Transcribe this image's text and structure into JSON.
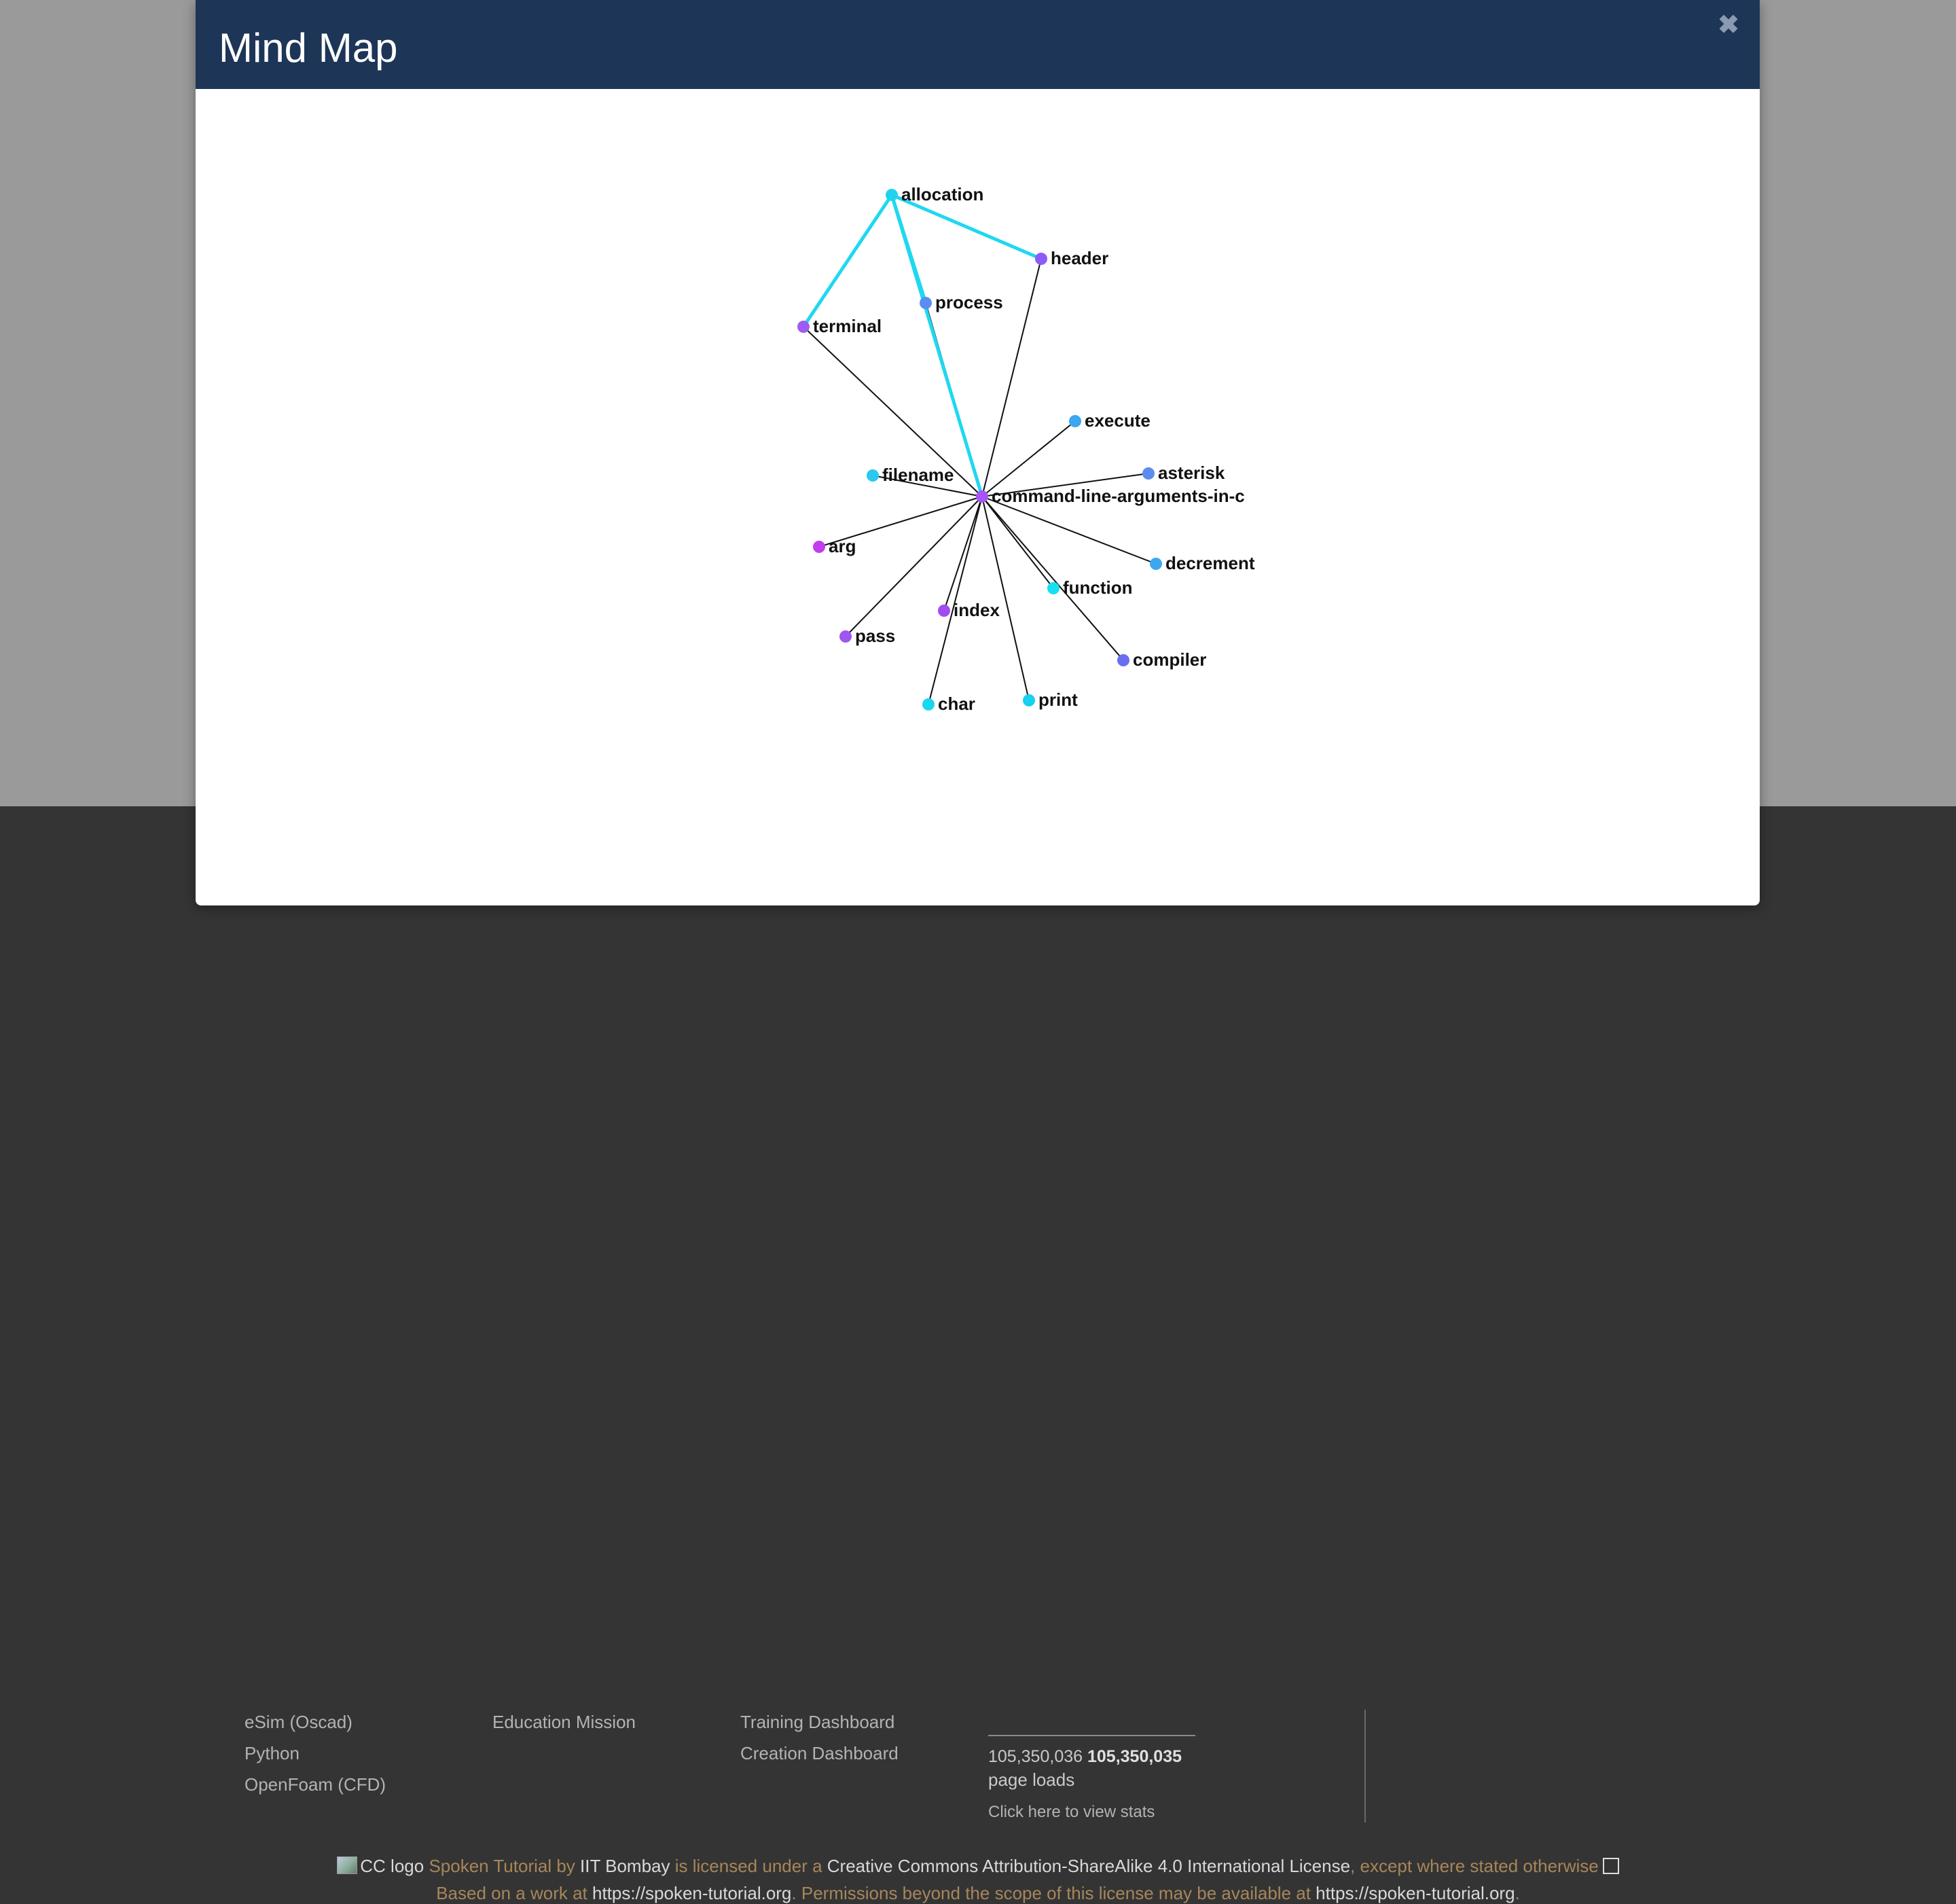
{
  "modal": {
    "title": "Mind Map",
    "close_icon": "close-icon"
  },
  "mindmap": {
    "center": "command-line-arguments-in-c",
    "nodes": [
      {
        "id": "command-line-arguments-in-c",
        "color": "#a855f7"
      },
      {
        "id": "allocation",
        "color": "#22d3ee"
      },
      {
        "id": "header",
        "color": "#8b5cf6"
      },
      {
        "id": "process",
        "color": "#5b8def"
      },
      {
        "id": "terminal",
        "color": "#9f5cf0"
      },
      {
        "id": "execute",
        "color": "#3ba7f0"
      },
      {
        "id": "asterisk",
        "color": "#5b8def"
      },
      {
        "id": "filename",
        "color": "#2cc8f0"
      },
      {
        "id": "arg",
        "color": "#c43cf0"
      },
      {
        "id": "decrement",
        "color": "#3ba7f0"
      },
      {
        "id": "function",
        "color": "#18e0f0"
      },
      {
        "id": "index",
        "color": "#a44cf0"
      },
      {
        "id": "pass",
        "color": "#a155f0"
      },
      {
        "id": "compiler",
        "color": "#6a6ff0"
      },
      {
        "id": "char",
        "color": "#18d8f0"
      },
      {
        "id": "print",
        "color": "#18d0f0"
      }
    ],
    "links": [
      {
        "source": "command-line-arguments-in-c",
        "target": "allocation",
        "highlight": true
      },
      {
        "source": "command-line-arguments-in-c",
        "target": "header",
        "highlight": false
      },
      {
        "source": "command-line-arguments-in-c",
        "target": "process",
        "highlight": false
      },
      {
        "source": "command-line-arguments-in-c",
        "target": "terminal",
        "highlight": false
      },
      {
        "source": "command-line-arguments-in-c",
        "target": "execute",
        "highlight": false
      },
      {
        "source": "command-line-arguments-in-c",
        "target": "asterisk",
        "highlight": false
      },
      {
        "source": "command-line-arguments-in-c",
        "target": "filename",
        "highlight": false
      },
      {
        "source": "command-line-arguments-in-c",
        "target": "arg",
        "highlight": false
      },
      {
        "source": "command-line-arguments-in-c",
        "target": "decrement",
        "highlight": false
      },
      {
        "source": "command-line-arguments-in-c",
        "target": "function",
        "highlight": false
      },
      {
        "source": "command-line-arguments-in-c",
        "target": "index",
        "highlight": false
      },
      {
        "source": "command-line-arguments-in-c",
        "target": "pass",
        "highlight": false
      },
      {
        "source": "command-line-arguments-in-c",
        "target": "compiler",
        "highlight": false
      },
      {
        "source": "command-line-arguments-in-c",
        "target": "char",
        "highlight": false
      },
      {
        "source": "command-line-arguments-in-c",
        "target": "print",
        "highlight": false
      },
      {
        "source": "allocation",
        "target": "terminal",
        "highlight": true
      },
      {
        "source": "allocation",
        "target": "header",
        "highlight": true
      },
      {
        "source": "allocation",
        "target": "process",
        "highlight": true
      }
    ],
    "highlight_color": "#1fd8f0",
    "link_color": "#111111"
  },
  "footer": {
    "col1": [
      "eSim (Oscad)",
      "Python",
      "OpenFoam (CFD)"
    ],
    "col2": [
      "Education Mission"
    ],
    "col3": [
      "Training Dashboard",
      "Creation Dashboard"
    ],
    "stats": {
      "count_a": "105,350,036",
      "count_b": "105,350,035",
      "label": "page loads",
      "link": "Click here to view stats"
    },
    "license": {
      "cc_logo_alt": "CC logo",
      "work": "Spoken Tutorial",
      "by": " by ",
      "author": "IIT Bombay",
      "licensed": " is licensed under a ",
      "license_name": "Creative Commons Attribution-ShareAlike 4.0 International License",
      "comma": ", ",
      "except": "except where stated otherwise",
      "based": "Based on a work at ",
      "url1": "https://spoken-tutorial.org",
      "period1": ". ",
      "permissions": "Permissions beyond the scope of this license may be available at ",
      "url2": "https://spoken-tutorial.org",
      "period2": "."
    }
  }
}
